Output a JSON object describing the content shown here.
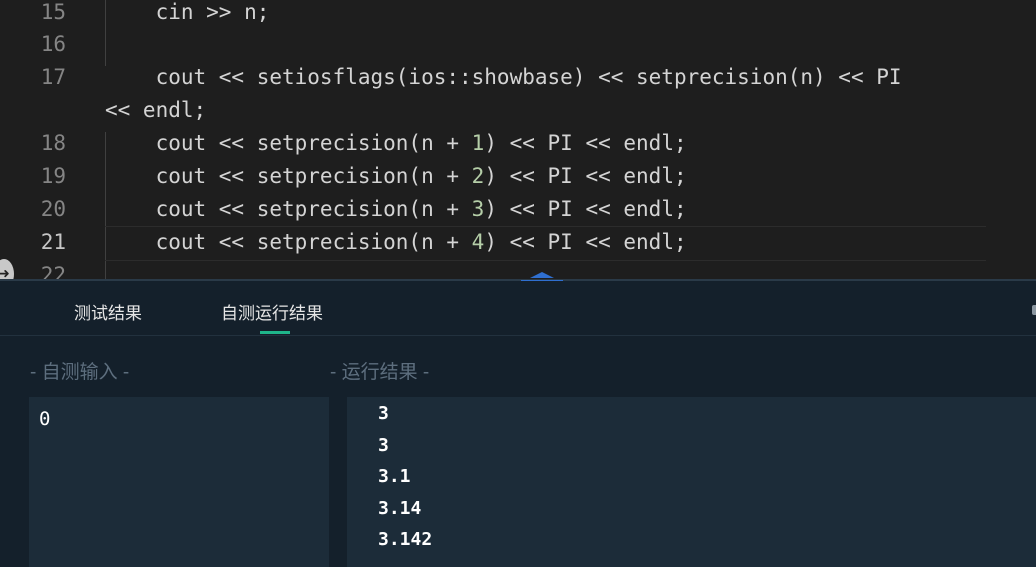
{
  "editor": {
    "lines": [
      {
        "no": "15",
        "segments": [
          {
            "t": "    cin >> n;"
          }
        ]
      },
      {
        "no": "16",
        "segments": []
      },
      {
        "no": "17",
        "segments": [
          {
            "t": "    cout << setiosflags(ios::showbase) << setprecision(n) << PI"
          }
        ]
      },
      {
        "no": "",
        "segments": [
          {
            "t": "<< endl;"
          }
        ],
        "wrap": true
      },
      {
        "no": "18",
        "segments": [
          {
            "t": "    cout << setprecision(n + "
          },
          {
            "t": "1",
            "num": true
          },
          {
            "t": ") << PI << endl;"
          }
        ]
      },
      {
        "no": "19",
        "segments": [
          {
            "t": "    cout << setprecision(n + "
          },
          {
            "t": "2",
            "num": true
          },
          {
            "t": ") << PI << endl;"
          }
        ]
      },
      {
        "no": "20",
        "segments": [
          {
            "t": "    cout << setprecision(n + "
          },
          {
            "t": "3",
            "num": true
          },
          {
            "t": ") << PI << endl;"
          }
        ]
      },
      {
        "no": "21",
        "segments": [
          {
            "t": "    cout << setprecision(n + "
          },
          {
            "t": "4",
            "num": true
          },
          {
            "t": ") << PI << endl;"
          }
        ],
        "active": true
      },
      {
        "no": "22",
        "segments": []
      }
    ],
    "fold_icon": "arrow-right-icon",
    "resize_icon": "drag-resize-icon"
  },
  "panel": {
    "tabs": {
      "test_results": "测试结果",
      "self_test_results": "自测运行结果"
    },
    "input_label": "- 自测输入 -",
    "output_label": "- 运行结果 -",
    "input_value": "0",
    "output_lines": [
      "3",
      "3",
      "3.1",
      "3.14",
      "3.142"
    ]
  },
  "colors": {
    "editor_bg": "#1e1e1e",
    "panel_bg": "#14202b",
    "box_bg": "#1c2c39",
    "accent": "#1fb58a",
    "resize_handle": "#2f6fd0",
    "number": "#b5cea8"
  }
}
